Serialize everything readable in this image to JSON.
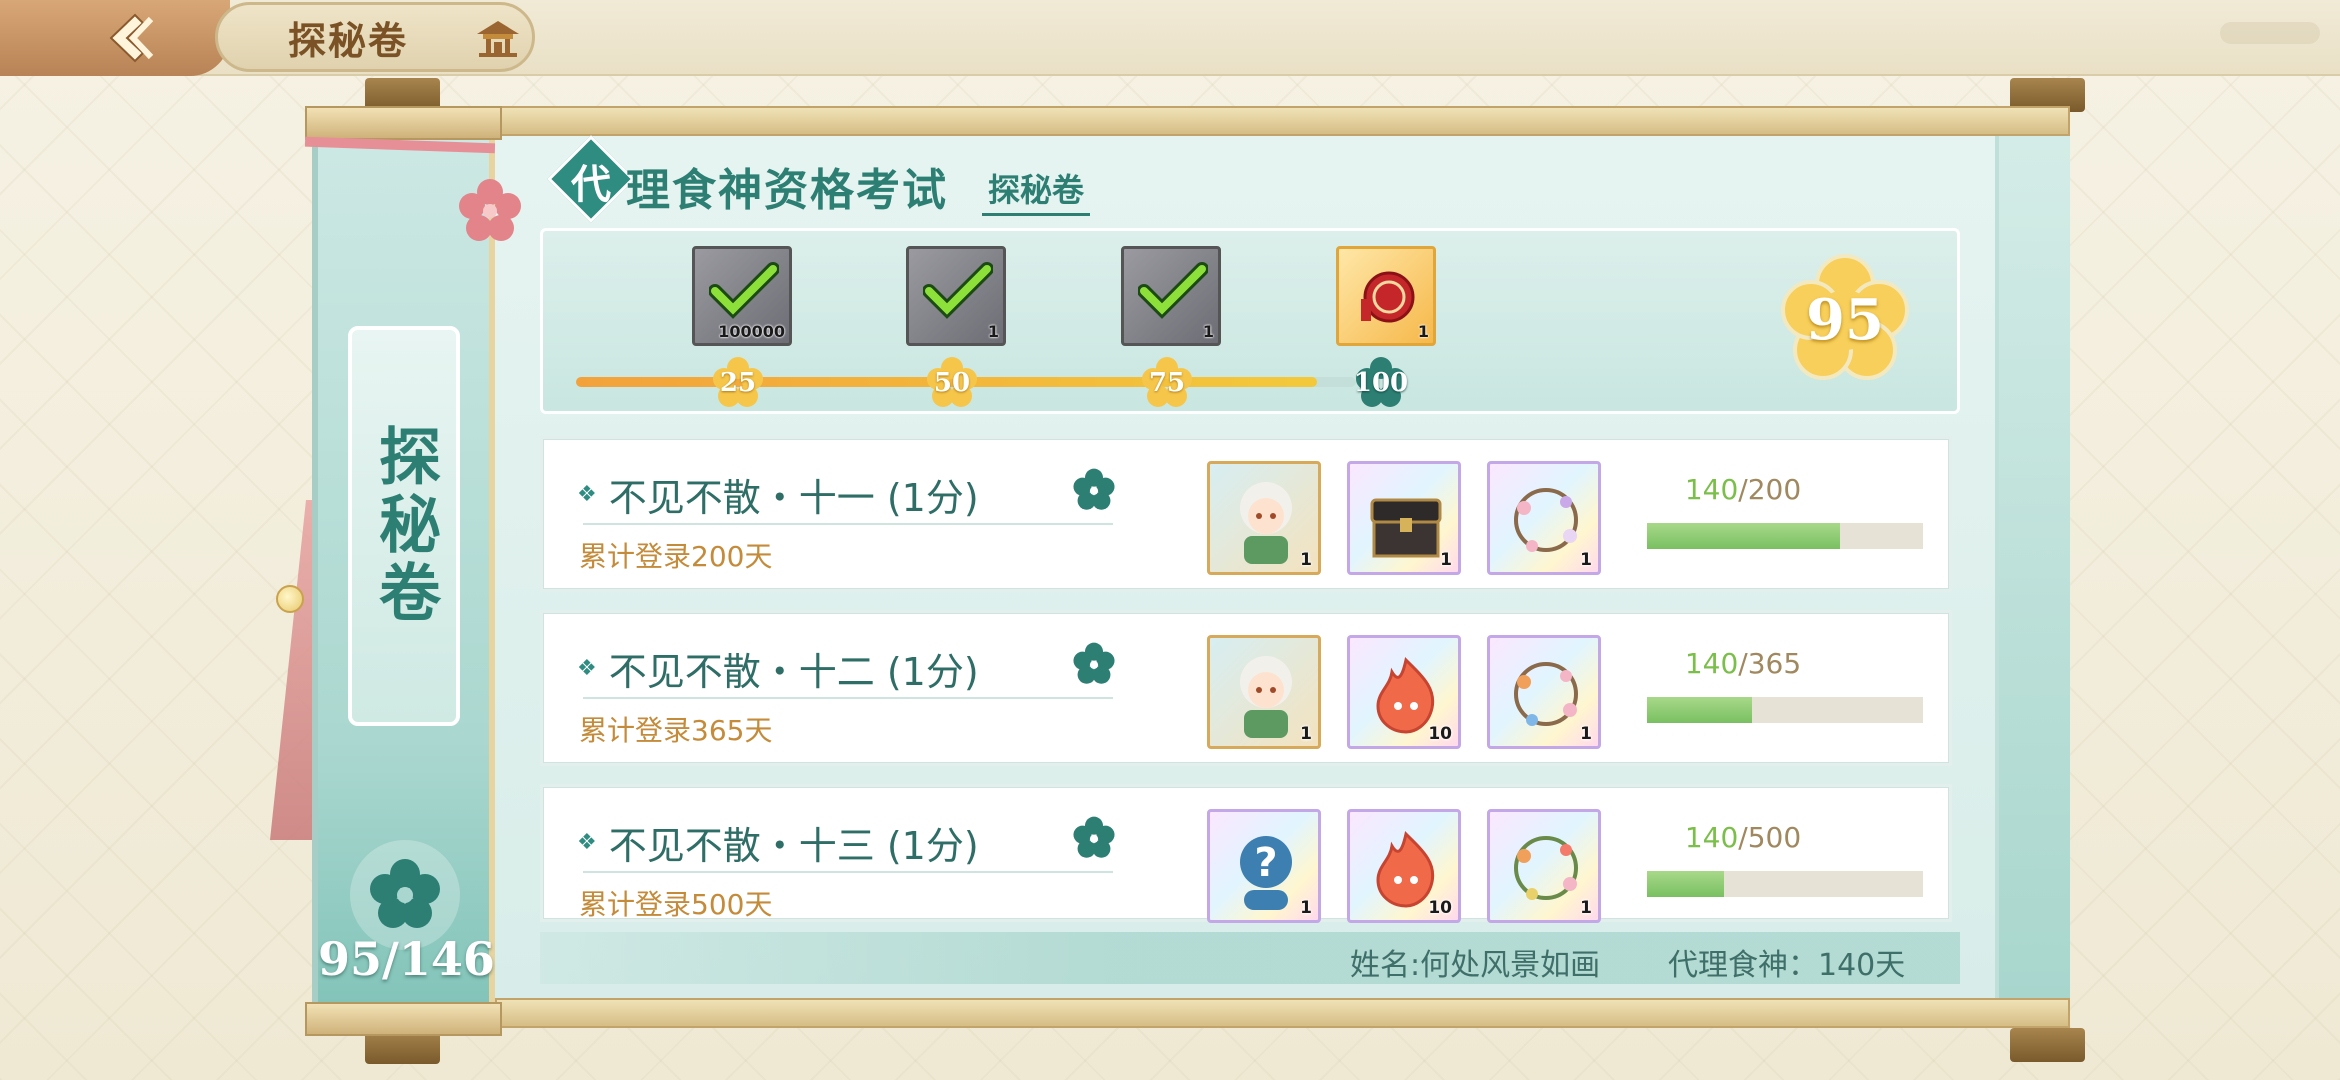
{
  "header": {
    "title": "探秘卷"
  },
  "left_panel": {
    "title": "探秘卷",
    "progress": "95/146"
  },
  "exam": {
    "badge_char": "代",
    "title": "理食神资格考试",
    "subtitle": "探秘卷"
  },
  "milestones": {
    "current_score": 95,
    "total_score_label": "95",
    "max_score": 100,
    "items": [
      {
        "threshold": "25",
        "qty": "100000",
        "claimed": true
      },
      {
        "threshold": "50",
        "qty": "1",
        "claimed": true
      },
      {
        "threshold": "75",
        "qty": "1",
        "claimed": true
      },
      {
        "threshold": "100",
        "qty": "1",
        "claimed": false
      }
    ]
  },
  "tasks": [
    {
      "name": "不见不散・十一 (1分)",
      "desc": "累计登录200天",
      "progress_current": "140",
      "progress_total": "/200",
      "progress_fraction": 0.7,
      "rewards": [
        {
          "icon": "character-portrait-icon",
          "qty": "1"
        },
        {
          "icon": "treasure-chest-icon",
          "qty": "1"
        },
        {
          "icon": "flower-wreath-icon",
          "qty": "1"
        }
      ]
    },
    {
      "name": "不见不散・十二 (1分)",
      "desc": "累计登录365天",
      "progress_current": "140",
      "progress_total": "/365",
      "progress_fraction": 0.38,
      "rewards": [
        {
          "icon": "character-portrait-icon",
          "qty": "1"
        },
        {
          "icon": "fire-spirit-icon",
          "qty": "10"
        },
        {
          "icon": "flower-wreath-icon",
          "qty": "1"
        }
      ]
    },
    {
      "name": "不见不散・十三 (1分)",
      "desc": "累计登录500天",
      "progress_current": "140",
      "progress_total": "/500",
      "progress_fraction": 0.28,
      "rewards": [
        {
          "icon": "mystery-question-icon",
          "qty": "1"
        },
        {
          "icon": "fire-spirit-icon",
          "qty": "10"
        },
        {
          "icon": "flower-wreath-icon",
          "qty": "1"
        }
      ]
    }
  ],
  "footer": {
    "name": "姓名:何处风景如画",
    "days": "代理食神：140天"
  },
  "colors": {
    "teal": "#2d7f74",
    "gold": "#f3b83b",
    "progress_green": "#79c061",
    "desc_brown": "#c48b3a"
  }
}
